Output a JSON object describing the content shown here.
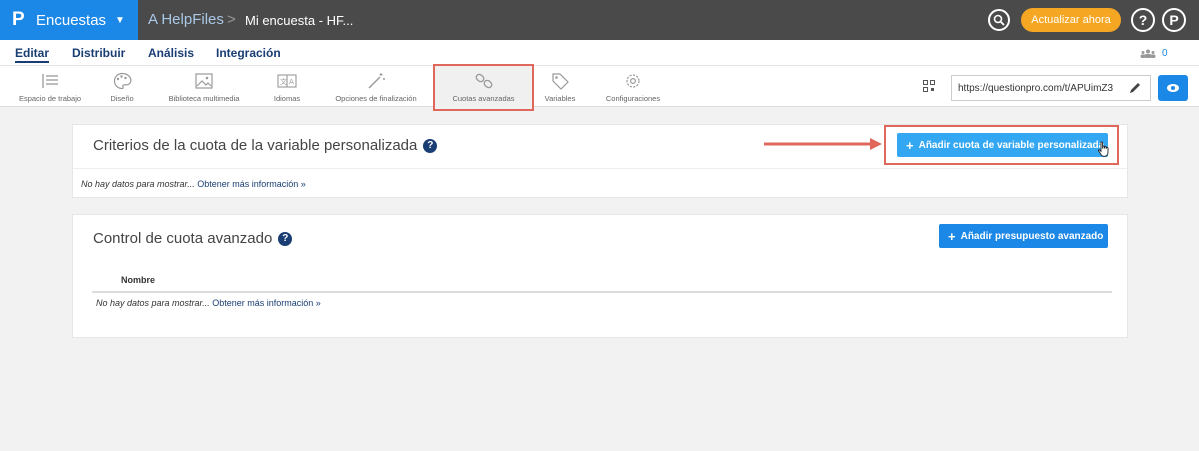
{
  "topbar": {
    "logo": "P",
    "product": "Encuestas",
    "breadcrumb_root": "A HelpFiles",
    "breadcrumb_sep": ">",
    "survey_name": "Mi encuesta - HF...",
    "upgrade_label": "Actualizar ahora",
    "help_label": "?",
    "user_label": "P"
  },
  "subnav": {
    "items": [
      "Editar",
      "Distribuir",
      "Análisis",
      "Integración"
    ],
    "active": "Editar",
    "collaborators_count": "0"
  },
  "toolbar": {
    "tools": [
      {
        "label": "Espacio de trabajo",
        "icon": "workspace-icon"
      },
      {
        "label": "Diseño",
        "icon": "palette-icon"
      },
      {
        "label": "Biblioteca multimedia",
        "icon": "image-icon"
      },
      {
        "label": "Idiomas",
        "icon": "translate-icon"
      },
      {
        "label": "Opciones de finalización",
        "icon": "wand-icon"
      },
      {
        "label": "Cuotas avanzadas",
        "icon": "link-icon"
      },
      {
        "label": "Variables",
        "icon": "tag-icon"
      },
      {
        "label": "Configuraciones",
        "icon": "gear-icon"
      }
    ],
    "active": "Cuotas avanzadas",
    "survey_url": "https://questionpro.com/t/APUimZ3"
  },
  "custom_quota": {
    "title": "Criterios de la cuota de la variable personalizada",
    "add_button": "Añadir cuota de variable personalizada",
    "empty_text": "No hay datos para mostrar...",
    "more_link": "Obtener más información »"
  },
  "advanced_quota": {
    "title": "Control de cuota avanzado",
    "add_button": "Añadir presupuesto avanzado",
    "column_name": "Nombre",
    "empty_text": "No hay datos para mostrar...",
    "more_link": "Obtener más información »"
  },
  "colors": {
    "brand_blue": "#1b87e6",
    "topbar": "#4a4a4a",
    "upgrade": "#f5a623",
    "nav_text": "#1a3e73",
    "highlight": "#e0675c"
  }
}
